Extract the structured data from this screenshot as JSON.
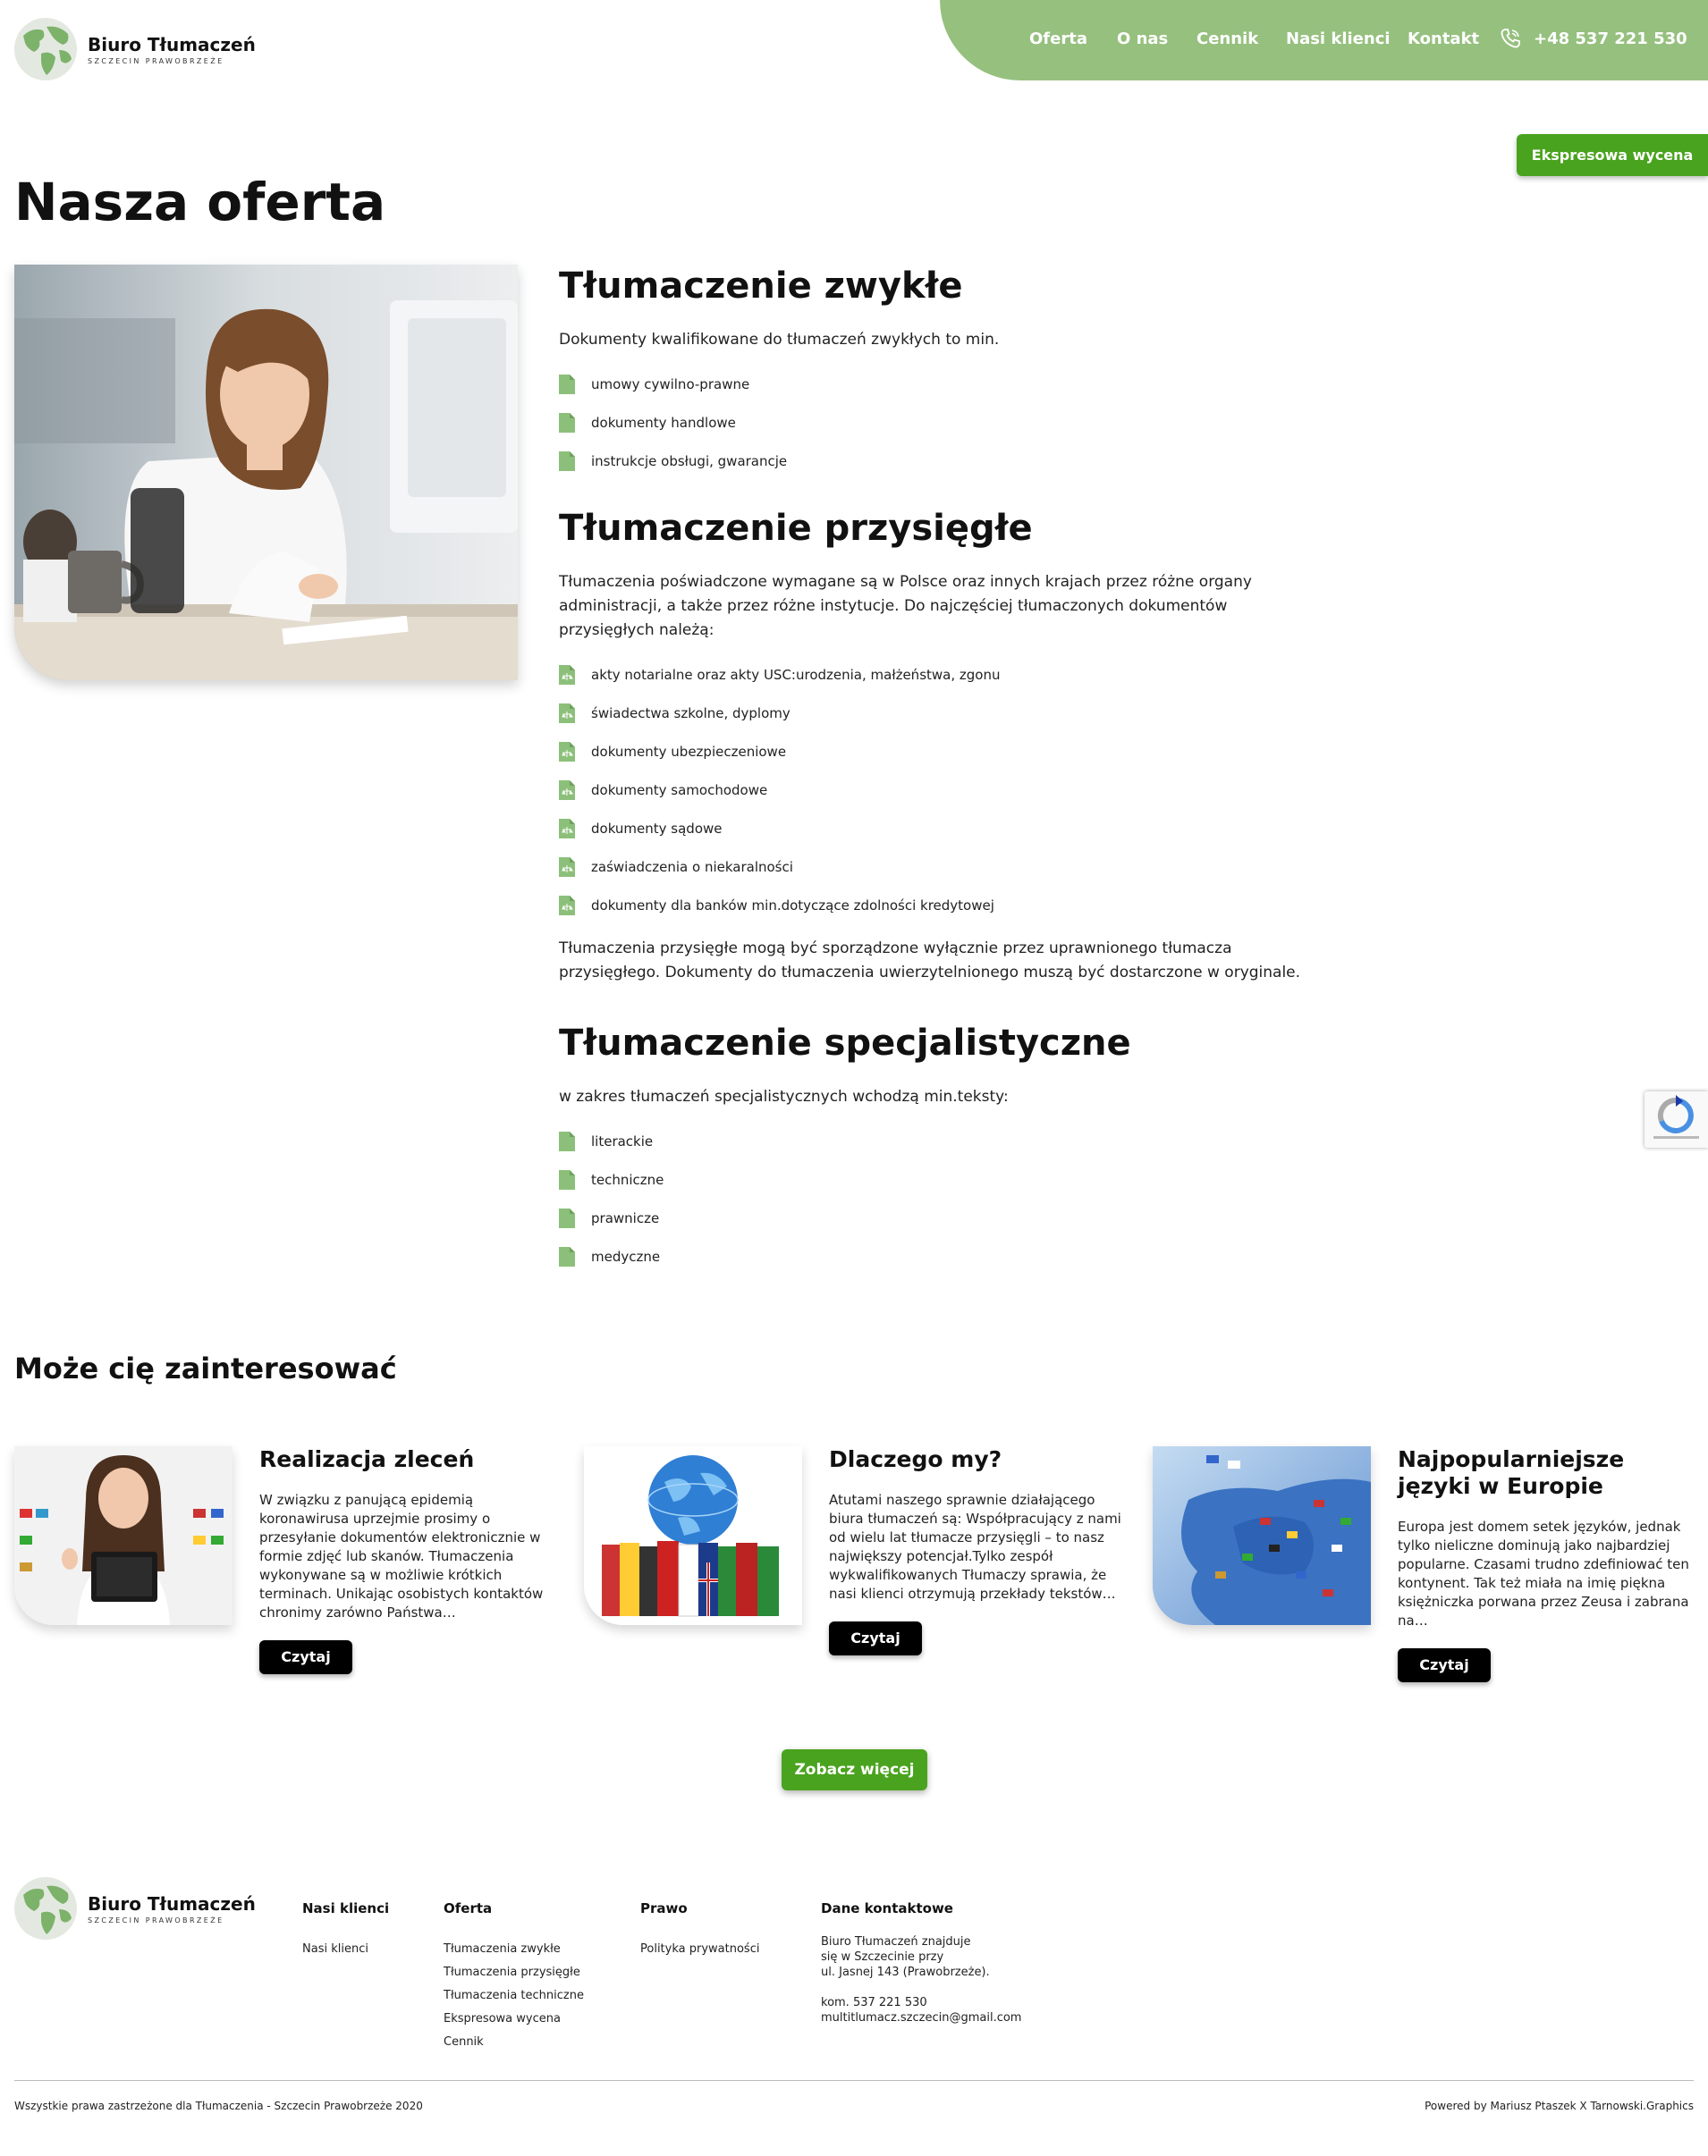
{
  "header": {
    "logo_name": "Biuro Tłumaczeń",
    "logo_sub": "SZCZECIN PRAWOBRZEŻE",
    "nav": [
      "Oferta",
      "O nas",
      "Cennik",
      "Nasi klienci",
      "Kontakt"
    ],
    "phone": "+48 537 221 530",
    "express_button": "Ekspresowa wycena"
  },
  "page_title": "Nasza oferta",
  "services": [
    {
      "title": "Tłumaczenie zwykłe",
      "intro": "Dokumenty kwalifikowane do tłumaczeń zwykłych to min.",
      "items": [
        "umowy cywilno-prawne",
        "dokumenty handlowe",
        "instrukcje obsługi, gwarancje"
      ]
    },
    {
      "title": "Tłumaczenie przysięgłe",
      "intro": "Tłumaczenia poświadczone wymagane są w Polsce oraz innych krajach przez różne organy administracji, a także przez różne instytucje. Do najczęściej tłumaczonych dokumentów przysięgłych należą:",
      "items": [
        "akty notarialne oraz akty USC:urodzenia, małżeństwa, zgonu",
        "świadectwa szkolne, dyplomy",
        "dokumenty ubezpieczeniowe",
        "dokumenty samochodowe",
        "dokumenty sądowe",
        "zaświadczenia o niekaralności",
        "dokumenty dla banków min.dotyczące zdolności kredytowej"
      ],
      "outro": "Tłumaczenia przysięgłe mogą być sporządzone wyłącznie przez uprawnionego tłumacza przysięgłego. Dokumenty do tłumaczenia uwierzytelnionego muszą być dostarczone w oryginale."
    },
    {
      "title": "Tłumaczenie specjalistyczne",
      "intro": "w zakres tłumaczeń specjalistycznych wchodzą min.teksty:",
      "items": [
        "literackie",
        "techniczne",
        "prawnicze",
        "medyczne"
      ]
    }
  ],
  "interest": {
    "title": "Może cię zainteresować",
    "cards": [
      {
        "title": "Realizacja zleceń",
        "text": "W związku z panującą epidemią koronawirusa uprzejmie prosimy  o przesyłanie dokumentów elektronicznie w formie zdjęć lub skanów. Tłumaczenia wykonywane są w możliwie krótkich terminach. Unikając osobistych kontaktów chronimy zarówno Państwa…",
        "button": "Czytaj"
      },
      {
        "title": "Dlaczego my?",
        "text": "Atutami naszego sprawnie działającego biura tłumaczeń są: Współpracujący z nami od wielu lat tłumacze przysięgli – to nasz największy potencjał.Tylko zespół wykwalifikowanych Tłumaczy sprawia, że nasi klienci otrzymują przekłady tekstów…",
        "button": "Czytaj"
      },
      {
        "title": "Najpopularniejsze języki w Europie",
        "text": "Europa jest domem setek języków, jednak tylko nieliczne dominują jako najbardziej popularne. Czasami trudno zdefiniować  ten kontynent. Tak też miała na imię piękna księżniczka porwana przez Zeusa  i zabrana na…",
        "button": "Czytaj"
      }
    ],
    "see_more": "Zobacz więcej"
  },
  "footer": {
    "col_clients": {
      "heading": "Nasi klienci",
      "links": [
        "Nasi klienci"
      ]
    },
    "col_offer": {
      "heading": "Oferta",
      "links": [
        "Tłumaczenia zwykłe",
        "Tłumaczenia przysięgłe",
        "Tłumaczenia techniczne",
        "Ekspresowa wycena",
        "Cennik"
      ]
    },
    "col_law": {
      "heading": "Prawo",
      "links": [
        "Polityka prywatności"
      ]
    },
    "col_contact": {
      "heading": "Dane kontaktowe",
      "lines": [
        "Biuro Tłumaczeń znajduje",
        "się w Szczecinie przy",
        "ul. Jasnej 143 (Prawobrzeże).",
        "",
        "kom. 537 221 530",
        "multitlumacz.szczecin@gmail.com"
      ]
    },
    "copyright": "Wszystkie prawa zastrzeżone dla Tłumaczenia - Szczecin Prawobrzeże 2020",
    "powered": "Powered by Mariusz Ptaszek X Tarnowski.Graphics"
  },
  "colors": {
    "accent_green": "#96c07e",
    "button_green": "#4aa31e",
    "icon_green": "#8cc07a"
  }
}
